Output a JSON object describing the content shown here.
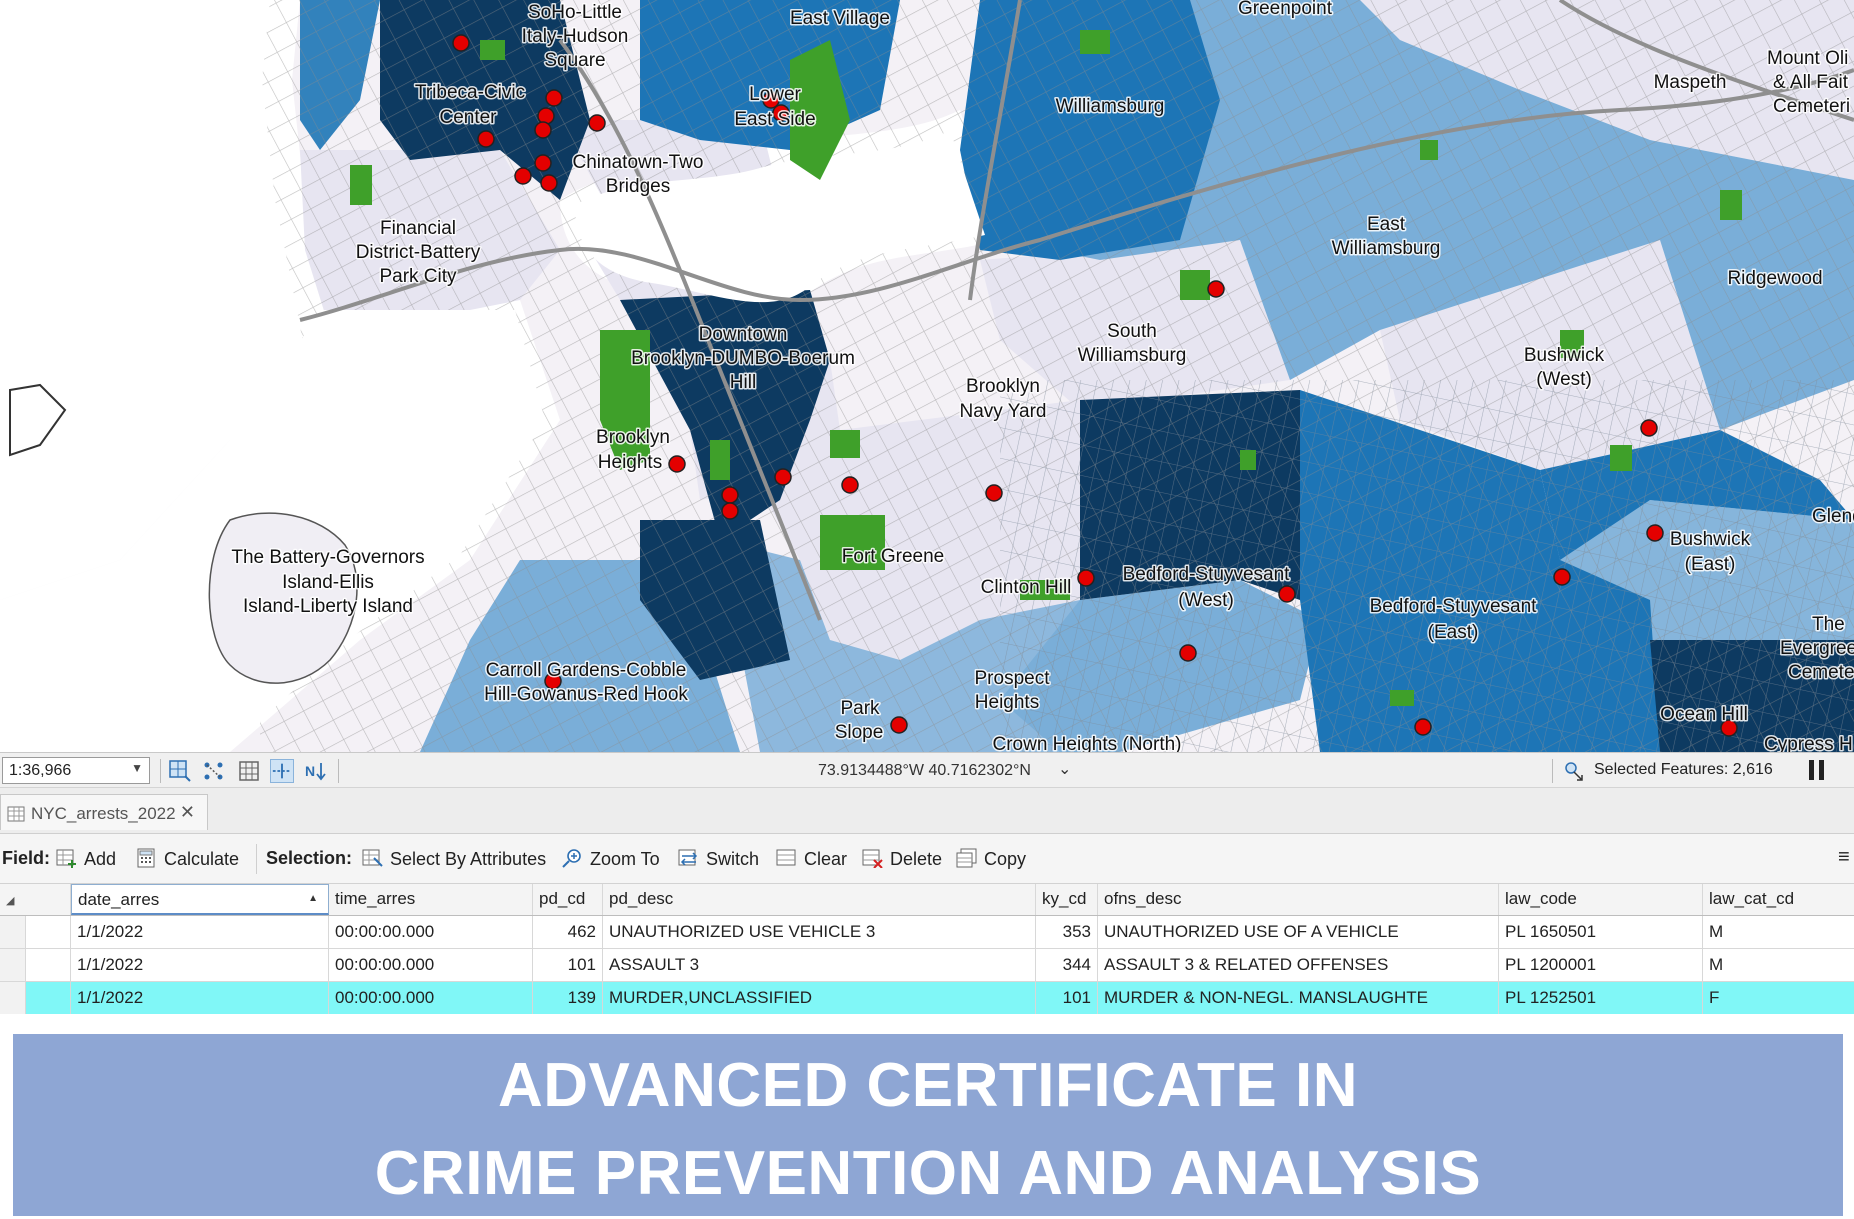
{
  "map": {
    "labels": {
      "soho": "SoHo-Little Italy-Hudson Square",
      "soho_l1": "SoHo-Little",
      "soho_l2": "Italy-Hudson",
      "soho_l3": "Square",
      "east_village": "East Village",
      "greenpoint": "Greenpoint",
      "mount_olivet_l1": "Mount Oli",
      "mount_olivet_l2": "& All Fait",
      "mount_olivet_l3": "Cemeteri",
      "maspeth": "Maspeth",
      "tribeca_l1": "Tribeca-Civic",
      "tribeca_l2": "Center",
      "les_l1": "Lower",
      "les_l2": "East Side",
      "williamsburg": "Williamsburg",
      "chinatown_l1": "Chinatown-Two",
      "chinatown_l2": "Bridges",
      "fidi_l1": "Financial",
      "fidi_l2": "District-Battery",
      "fidi_l3": "Park City",
      "east_wburg_l1": "East",
      "east_wburg_l2": "Williamsburg",
      "ridgewood": "Ridgewood",
      "downtown_l1": "Downtown",
      "downtown_l2": "Brooklyn-DUMBO-Boerum",
      "downtown_l3": "Hill",
      "south_wburg_l1": "South",
      "south_wburg_l2": "Williamsburg",
      "bushwick_w_l1": "Bushwick",
      "bushwick_w_l2": "(West)",
      "navy_yard_l1": "Brooklyn",
      "navy_yard_l2": "Navy Yard",
      "bk_heights_l1": "Brooklyn",
      "bk_heights_l2": "Heights",
      "glendale": "Glend",
      "battery_l1": "The Battery-Governors",
      "battery_l2": "Island-Ellis",
      "battery_l3": "Island-Liberty Island",
      "fort_greene": "Fort Greene",
      "bushwick_e_l1": "Bushwick",
      "bushwick_e_l2": "(East)",
      "clinton_hill": "Clinton Hill",
      "bedstuy_w_l1": "Bedford-Stuyvesant",
      "bedstuy_w_l2": "(West)",
      "bedstuy_e_l1": "Bedford-Stuyvesant",
      "bedstuy_e_l2": "(East)",
      "evergreens_l1": "The",
      "evergreens_l2": "Evergree",
      "evergreens_l3": "Cemete",
      "carroll_l1": "Carroll Gardens-Cobble",
      "carroll_l2": "Hill-Gowanus-Red Hook",
      "prospect_l1": "Prospect",
      "prospect_l2": "Heights",
      "park_slope_l1": "Park",
      "park_slope_l2": "Slope",
      "ocean_hill": "Ocean Hill",
      "crown_heights": "Crown Heights (North)",
      "cypress": "Cypress H"
    },
    "colors": {
      "class1": "#e8e6f2",
      "class2": "#7fb0d9",
      "class3": "#1f77b8",
      "class4": "#0e3b63",
      "park": "#3fa02a",
      "water": "#ffffff",
      "point": "#e40000"
    }
  },
  "statusbar": {
    "scale": "1:36,966",
    "coordinates": "73.9134488°W 40.7162302°N",
    "selected_features": "Selected Features: 2,616"
  },
  "table_tab": {
    "name": "NYC_arrests_2022"
  },
  "toolbar": {
    "field_label": "Field:",
    "add": "Add",
    "calculate": "Calculate",
    "selection_label": "Selection:",
    "select_by_attributes": "Select By Attributes",
    "zoom_to": "Zoom To",
    "switch": "Switch",
    "clear": "Clear",
    "delete": "Delete",
    "copy": "Copy"
  },
  "table": {
    "columns": [
      "date_arres",
      "time_arres",
      "pd_cd",
      "pd_desc",
      "ky_cd",
      "ofns_desc",
      "law_code",
      "law_cat_cd"
    ],
    "rows": [
      [
        "1/1/2022",
        "00:00:00.000",
        "462",
        "UNAUTHORIZED USE VEHICLE 3",
        "353",
        "UNAUTHORIZED USE OF A VEHICLE",
        "PL 1650501",
        "M"
      ],
      [
        "1/1/2022",
        "00:00:00.000",
        "101",
        "ASSAULT 3",
        "344",
        "ASSAULT 3 & RELATED OFFENSES",
        "PL 1200001",
        "M"
      ],
      [
        "1/1/2022",
        "00:00:00.000",
        "139",
        "MURDER,UNCLASSIFIED",
        "101",
        "MURDER & NON-NEGL. MANSLAUGHTE",
        "PL 1252501",
        "F"
      ]
    ]
  },
  "banner": {
    "line1": "ADVANCED CERTIFICATE IN",
    "line2": "CRIME PREVENTION AND ANALYSIS"
  }
}
